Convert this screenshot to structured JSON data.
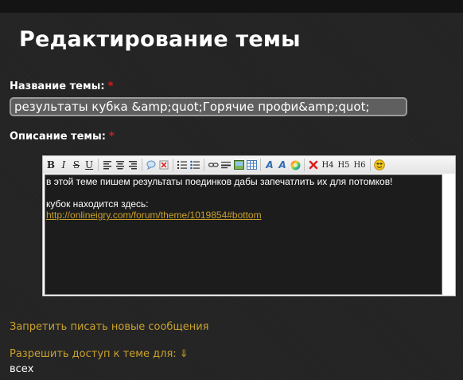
{
  "page": {
    "title": "Редактирование темы"
  },
  "form": {
    "name_label": "Название темы:",
    "required_mark": "*",
    "name_value": "результаты кубка &amp;quot;Горячие профи&amp;quot;",
    "description_label": "Описание темы:",
    "editor": {
      "toolbar": [
        "bold",
        "italic",
        "strikethrough",
        "underline",
        "align-left",
        "align-center",
        "align-right",
        "quote",
        "remove-format",
        "ordered-list",
        "unordered-list",
        "link",
        "horizontal-rule",
        "image",
        "table",
        "text-color",
        "background-color",
        "color-picker",
        "delete",
        "h4",
        "h5",
        "h6",
        "smiley"
      ],
      "h4_label": "H4",
      "h5_label": "H5",
      "h6_label": "H6",
      "line1": "в этой теме пишем результаты поединков дабы запечатлить их для потомков!",
      "line2": "кубок находится здесь:",
      "link": "http://onlineigry.com/forum/theme/1019854#bottom"
    }
  },
  "actions": {
    "disallow_posts": "Запретить писать новые сообщения",
    "access_label": "Разрешить доступ к теме для: ⇓",
    "access_value": "всех"
  },
  "colors": {
    "accent": "#c9a12c",
    "required": "#d42020",
    "background": "#232323"
  }
}
